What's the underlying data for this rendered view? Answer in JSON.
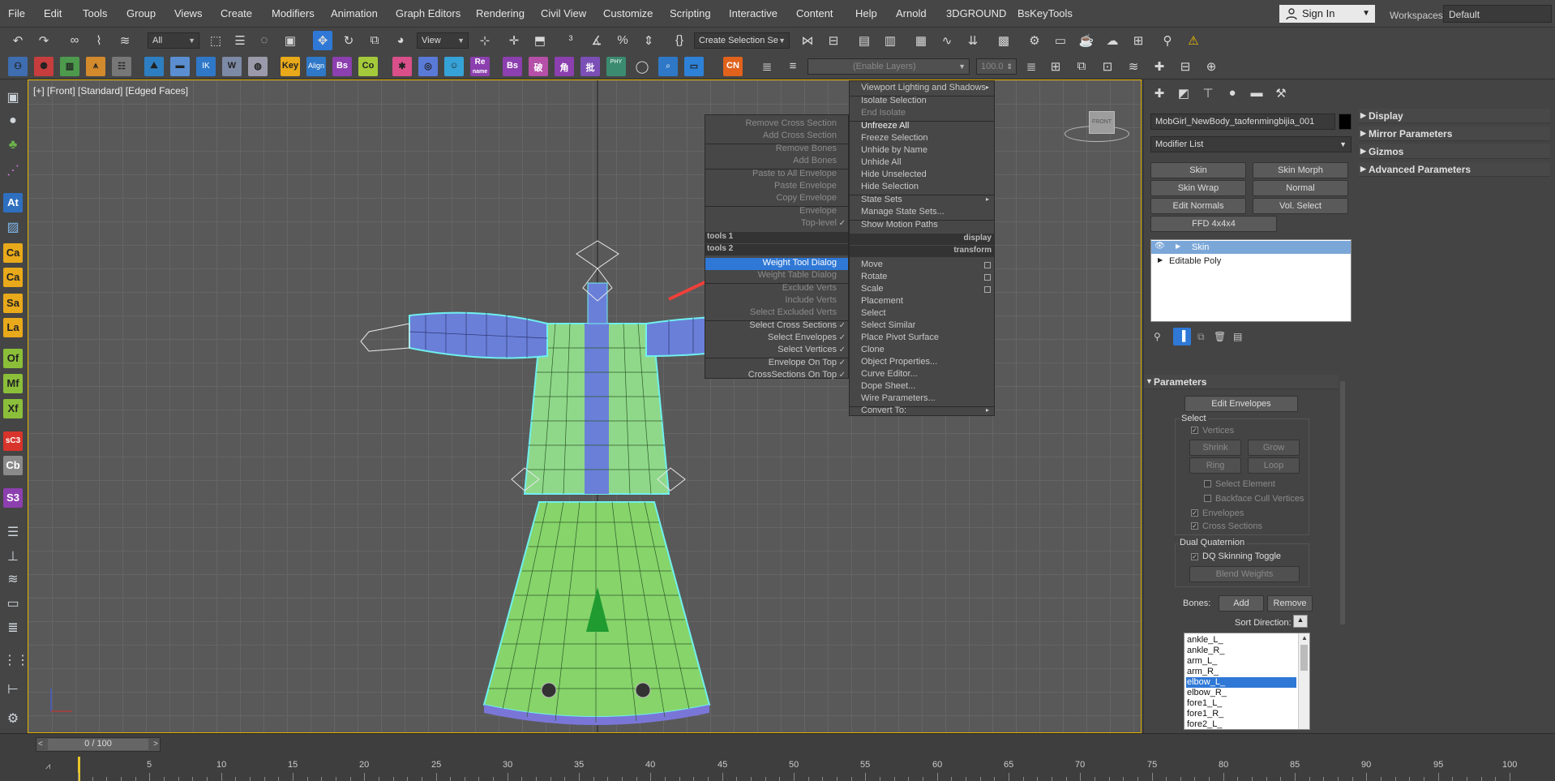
{
  "menubar": {
    "items": [
      "File",
      "Edit",
      "Tools",
      "Group",
      "Views",
      "Create",
      "Modifiers",
      "Animation",
      "Graph Editors",
      "Rendering",
      "Civil View",
      "Customize",
      "Scripting",
      "Interactive",
      "Content",
      "Help",
      "Arnold",
      "3DGROUND",
      "BsKeyTools"
    ],
    "sign_in": "Sign In",
    "workspaces_label": "Workspaces:",
    "workspaces_value": "Default"
  },
  "toolbar": {
    "filter": "All",
    "ref_coord": "View",
    "selection_set": "Create Selection Se",
    "enable_layers": "(Enable Layers)",
    "spinner_value": "100.0",
    "icons": {
      "key": "Key",
      "align": "Align",
      "bs14": "Bs",
      "co": "Co",
      "rename": "Re",
      "rename_sub": "name",
      "bs": "Bs",
      "phy_skin": "PHY",
      "cn": "CN"
    }
  },
  "left_toolbar": [
    "At",
    "Ca",
    "Ca",
    "Sa",
    "La",
    "Of",
    "Mf",
    "Xf",
    "sC3",
    "Cb",
    "S3"
  ],
  "viewport": {
    "label": "[+] [Front] [Standard] [Edged Faces]",
    "viewcube_label": "FRONT"
  },
  "quad_left": {
    "items": [
      {
        "label": "Remove Cross Section",
        "check": ""
      },
      {
        "label": "Add Cross Section",
        "check": ""
      },
      {
        "label": "Remove Bones",
        "check": ""
      },
      {
        "label": "Add Bones",
        "check": ""
      },
      {
        "label": "Paste to All Envelope",
        "check": ""
      },
      {
        "label": "Paste Envelope",
        "check": ""
      },
      {
        "label": "Copy Envelope",
        "check": ""
      },
      {
        "label": "Envelope",
        "check": ""
      },
      {
        "label": "Top-level",
        "check": "✓"
      },
      {
        "label": "Weight Tool Dialog",
        "check": ""
      },
      {
        "label": "Weight Table Dialog",
        "check": ""
      },
      {
        "label": "Exclude Verts",
        "check": ""
      },
      {
        "label": "Include Verts",
        "check": ""
      },
      {
        "label": "Select Excluded Verts",
        "check": ""
      },
      {
        "label": "Select Cross Sections",
        "check": "✓"
      },
      {
        "label": "Select Envelopes",
        "check": "✓"
      },
      {
        "label": "Select Vertices",
        "check": "✓"
      },
      {
        "label": "Envelope On Top",
        "check": "✓"
      },
      {
        "label": "CrossSections On Top",
        "check": "✓"
      }
    ],
    "header1": "tools 1",
    "header2": "tools 2"
  },
  "quad_right": {
    "items": [
      {
        "label": "Viewport Lighting and Shadows",
        "sub": "▸"
      },
      {
        "label": "Isolate Selection",
        "sub": ""
      },
      {
        "label": "End Isolate",
        "sub": ""
      },
      {
        "label": "Unfreeze All",
        "sub": ""
      },
      {
        "label": "Freeze Selection",
        "sub": ""
      },
      {
        "label": "Unhide by Name",
        "sub": ""
      },
      {
        "label": "Unhide All",
        "sub": ""
      },
      {
        "label": "Hide Unselected",
        "sub": ""
      },
      {
        "label": "Hide Selection",
        "sub": ""
      },
      {
        "label": "State Sets",
        "sub": "▸"
      },
      {
        "label": "Manage State Sets...",
        "sub": ""
      },
      {
        "label": "Show Motion Paths",
        "sub": ""
      },
      {
        "label": "Move",
        "sub": ""
      },
      {
        "label": "Rotate",
        "sub": ""
      },
      {
        "label": "Scale",
        "sub": ""
      },
      {
        "label": "Placement",
        "sub": ""
      },
      {
        "label": "Select",
        "sub": ""
      },
      {
        "label": "Select Similar",
        "sub": ""
      },
      {
        "label": "Place Pivot Surface",
        "sub": ""
      },
      {
        "label": "Clone",
        "sub": ""
      },
      {
        "label": "Object Properties...",
        "sub": ""
      },
      {
        "label": "Curve Editor...",
        "sub": ""
      },
      {
        "label": "Dope Sheet...",
        "sub": ""
      },
      {
        "label": "Wire Parameters...",
        "sub": ""
      },
      {
        "label": "Convert To:",
        "sub": "▸"
      }
    ],
    "header1": "display",
    "header2": "transform"
  },
  "command_panel": {
    "object_name": "MobGirl_NewBody_taofenmingbijia_001",
    "modifier_list": "Modifier List",
    "buttons": [
      "Skin",
      "Skin Morph",
      "Skin Wrap",
      "Normal",
      "Edit Normals",
      "Vol. Select",
      "FFD 4x4x4"
    ],
    "stack": [
      "Skin",
      "Editable Poly"
    ],
    "parameters": {
      "title": "Parameters",
      "edit_envelopes": "Edit Envelopes",
      "select_label": "Select",
      "vertices": "Vertices",
      "shrink": "Shrink",
      "grow": "Grow",
      "ring": "Ring",
      "loop": "Loop",
      "select_element": "Select Element",
      "backface": "Backface Cull Vertices",
      "envelopes": "Envelopes",
      "cross_sections": "Cross Sections",
      "dual_quaternion": "Dual Quaternion",
      "dq_toggle": "DQ Skinning Toggle",
      "blend_weights": "Blend Weights",
      "bones_label": "Bones:",
      "add": "Add",
      "remove": "Remove",
      "sort_direction": "Sort Direction:"
    },
    "bones": [
      "ankle_L_",
      "ankle_R_",
      "arm_L_",
      "arm_R_",
      "elbow_L_",
      "elbow_R_",
      "fore1_L_",
      "fore1_R_",
      "fore2_L_"
    ],
    "selected_bone_index": 4
  },
  "rollouts": [
    "Display",
    "Mirror Parameters",
    "Gizmos",
    "Advanced Parameters"
  ],
  "timeline": {
    "frame_display": "0 / 100",
    "prev": "<",
    "next": ">",
    "ticks": [
      "0",
      "5",
      "10",
      "15",
      "20",
      "25",
      "30",
      "35",
      "40",
      "45",
      "50",
      "55",
      "60",
      "65",
      "70",
      "75",
      "80",
      "85",
      "90",
      "95",
      "100"
    ]
  },
  "colors": {
    "accent_selection": "#2f78d6",
    "viewport_border": "#e1b000",
    "mesh_blue": "#6a7fd8",
    "mesh_green": "#8fd86a",
    "wire_cyan": "#7ff0f0"
  }
}
